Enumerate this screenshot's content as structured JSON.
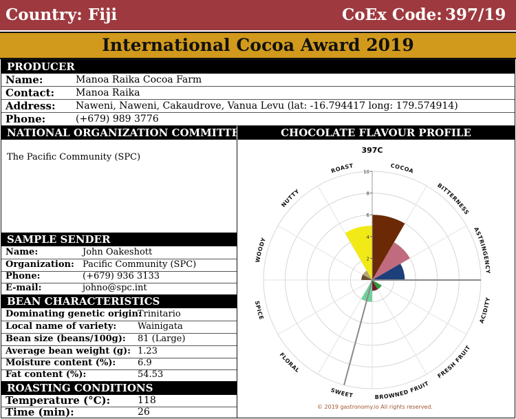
{
  "header": {
    "country_label": "Country:",
    "country_value": "Fiji",
    "coex_label": "CoEx Code:",
    "coex_value": "397/19"
  },
  "award_title": "International Cocoa Award 2019",
  "producer": {
    "heading": "PRODUCER",
    "name_label": "Name:",
    "name_value": "Manoa Raika Cocoa Farm",
    "contact_label": "Contact:",
    "contact_value": "Manoa Raika",
    "address_label": "Address:",
    "address_value": "Naweni, Naweni, Cakaudrove, Vanua Levu (lat: -16.794417   long: 179.574914)",
    "phone_label": "Phone:",
    "phone_value": "(+679) 989 3776"
  },
  "noc": {
    "heading": "NATIONAL ORGANIZATION COMMITTEE",
    "value": "The Pacific Community (SPC)"
  },
  "sender": {
    "heading": "SAMPLE SENDER",
    "name_label": "Name:",
    "name_value": "John Oakeshott",
    "org_label": "Organization:",
    "org_value": "Pacific Community (SPC)",
    "phone_label": "Phone:",
    "phone_value": "(+679) 936 3133",
    "email_label": "E-mail:",
    "email_value": "johno@spc.int"
  },
  "bean": {
    "heading": "BEAN CHARACTERISTICS",
    "origin_label": "Dominating genetic origin:",
    "origin_value": "Trinitario",
    "local_label": "Local name of variety:",
    "local_value": "Wainigata",
    "size_label": "Bean size (beans/100g):",
    "size_value": "81 (Large)",
    "weight_label": "Average bean weight (g):",
    "weight_value": "1.23",
    "moisture_label": "Moisture content (%):",
    "moisture_value": "6.9",
    "fat_label": "Fat content (%):",
    "fat_value": "54.53"
  },
  "roasting": {
    "heading": "ROASTING CONDITIONS",
    "temp_label": "Temperature (°C):",
    "temp_value": "118",
    "time_label": "Time (min):",
    "time_value": "26"
  },
  "profile_heading": "CHOCOLATE FLAVOUR PROFILE",
  "chart_data": {
    "type": "polar-area",
    "title": "397C",
    "rmax": 10,
    "ticks": [
      "2",
      "4",
      "6",
      "8",
      "10"
    ],
    "categories": [
      "COCOA",
      "BITTERNESS",
      "ASTRINGENCY",
      "ACIDITY",
      "FRESH FRUIT",
      "BROWNED FRUIT",
      "SWEET",
      "FLORAL",
      "SPICE",
      "WOODY",
      "NUTTY",
      "ROAST"
    ],
    "values": [
      6,
      4,
      3,
      0,
      1,
      1,
      2,
      0,
      0,
      1,
      1,
      5
    ],
    "colors": [
      "#6b2a05",
      "#c06b7e",
      "#1d3f7a",
      "#7fcfcf",
      "#2f9b3f",
      "#6e1f27",
      "#71d09b",
      "#d998c8",
      "#b23a38",
      "#6b4e2e",
      "#b6a774",
      "#f2ea17"
    ],
    "needles": [
      {
        "angle": 90,
        "value": 10
      },
      {
        "angle": 195,
        "value": 10
      }
    ],
    "copyright": "© 2019 gastronomy.io All rights reserved."
  }
}
